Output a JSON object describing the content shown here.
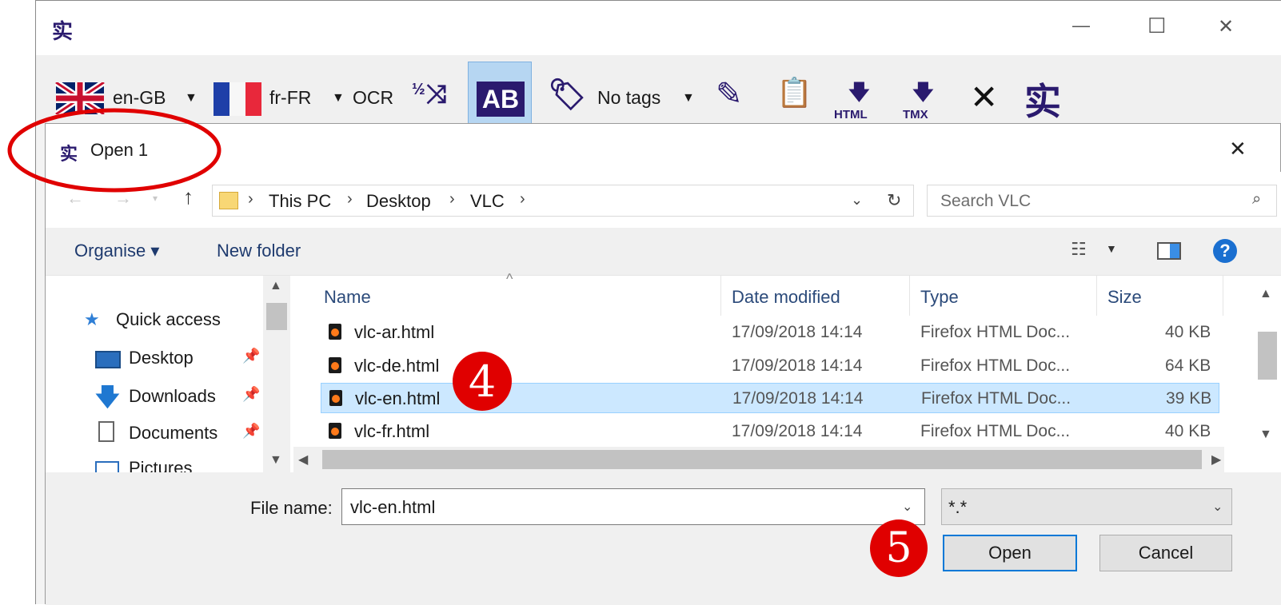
{
  "app": {
    "logo_glyph": "实",
    "window_controls": {
      "minimize": "—",
      "maximize": "☐",
      "close": "✕"
    },
    "toolbar": {
      "source_lang": "en-GB",
      "target_lang": "fr-FR",
      "ocr_label": "OCR",
      "ab_label": "AB",
      "tags_label": "No tags",
      "html_label": "HTML",
      "tmx_label": "TMX",
      "fraction_label": "1⁄2"
    }
  },
  "dialog": {
    "title": "Open 1",
    "close_glyph": "✕",
    "breadcrumb": [
      "This PC",
      "Desktop",
      "VLC"
    ],
    "search_placeholder": "Search VLC",
    "commands": {
      "organise": "Organise ▾",
      "new_folder": "New folder"
    },
    "nav_items": [
      "Quick access",
      "Desktop",
      "Downloads",
      "Documents",
      "Pictures"
    ],
    "columns": [
      "Name",
      "Date modified",
      "Type",
      "Size"
    ],
    "files": [
      {
        "name": "vlc-ar.html",
        "date": "17/09/2018 14:14",
        "type": "Firefox HTML Doc...",
        "size": "40 KB"
      },
      {
        "name": "vlc-de.html",
        "date": "17/09/2018 14:14",
        "type": "Firefox HTML Doc...",
        "size": "64 KB"
      },
      {
        "name": "vlc-en.html",
        "date": "17/09/2018 14:14",
        "type": "Firefox HTML Doc...",
        "size": "39 KB"
      },
      {
        "name": "vlc-fr.html",
        "date": "17/09/2018 14:14",
        "type": "Firefox HTML Doc...",
        "size": "40 KB"
      }
    ],
    "selected_file_index": 2,
    "filename_label": "File name:",
    "filename_value": "vlc-en.html",
    "filter_value": "*.*",
    "open_button": "Open",
    "cancel_button": "Cancel"
  },
  "annotations": {
    "step4": "4",
    "step5": "5",
    "highlight_color": "#e00000"
  }
}
